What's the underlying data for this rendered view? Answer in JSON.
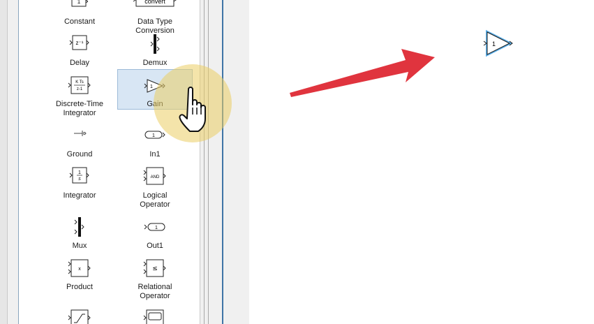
{
  "library": {
    "blocks": [
      {
        "label": "Constant",
        "icon": "constant-icon",
        "text": "1"
      },
      {
        "label": "Data Type Conversion",
        "icon": "convert-icon",
        "text": "convert"
      },
      {
        "label": "Delay",
        "icon": "delay-icon",
        "text": "z⁻¹"
      },
      {
        "label": "Demux",
        "icon": "demux-icon"
      },
      {
        "label": "Discrete-Time\nIntegrator",
        "icon": "discrete-integrator-icon",
        "text_top": "K Ts",
        "text_bottom": "z-1"
      },
      {
        "label": "Gain",
        "icon": "gain-icon",
        "text": "1"
      },
      {
        "label": "Ground",
        "icon": "ground-icon"
      },
      {
        "label": "In1",
        "icon": "in1-icon",
        "text": "1"
      },
      {
        "label": "Integrator",
        "icon": "integrator-icon",
        "text_top": "1",
        "text_bottom": "s"
      },
      {
        "label": "Logical\nOperator",
        "icon": "logical-operator-icon",
        "text": "AND"
      },
      {
        "label": "Mux",
        "icon": "mux-icon"
      },
      {
        "label": "Out1",
        "icon": "out1-icon",
        "text": "1"
      },
      {
        "label": "Product",
        "icon": "product-icon",
        "text": "x"
      },
      {
        "label": "Relational\nOperator",
        "icon": "relational-operator-icon",
        "text": "≤"
      }
    ],
    "selected": "Gain"
  },
  "canvas": {
    "gain_block_value": "1",
    "arrow_color": "#e0343e",
    "selection_color": "#5aaee8"
  },
  "cursor": {
    "icon": "hand-pointer-icon"
  }
}
